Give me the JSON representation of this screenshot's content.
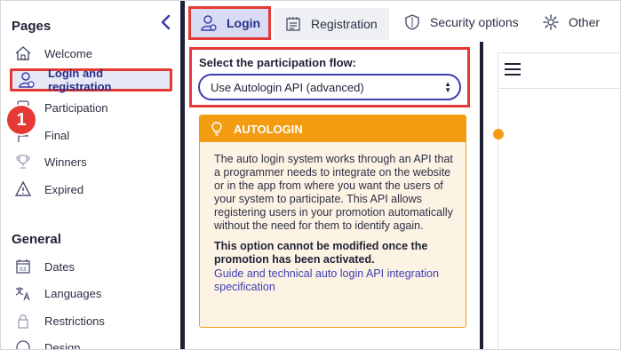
{
  "sidebar": {
    "pages_title": "Pages",
    "general_title": "General",
    "items": [
      {
        "label": "Welcome",
        "icon": "home-icon"
      },
      {
        "label": "Login and registration",
        "icon": "user-icon"
      },
      {
        "label": "Participation",
        "icon": "participation-icon"
      },
      {
        "label": "Final",
        "icon": "flag-icon"
      },
      {
        "label": "Winners",
        "icon": "trophy-icon"
      },
      {
        "label": "Expired",
        "icon": "warning-icon"
      }
    ],
    "general_items": [
      {
        "label": "Dates",
        "icon": "calendar-icon"
      },
      {
        "label": "Languages",
        "icon": "translate-icon"
      },
      {
        "label": "Restrictions",
        "icon": "lock-icon"
      },
      {
        "label": "Design",
        "icon": "palette-icon"
      }
    ],
    "step_badge": "1"
  },
  "tabs": [
    {
      "label": "Login",
      "icon": "user-icon"
    },
    {
      "label": "Registration",
      "icon": "form-icon"
    },
    {
      "label": "Security options",
      "icon": "shield-icon"
    },
    {
      "label": "Other",
      "icon": "gear-icon"
    }
  ],
  "flow": {
    "label": "Select the participation flow:",
    "selected": "Use Autologin API (advanced)"
  },
  "info": {
    "title": "AUTOLOGIN",
    "body": "The auto login system works through an API that a programmer needs to integrate on the website or in the app from where you want the users of your system to participate. This API allows registering users in your promotion automatically without the need for them to identify again.",
    "warning": "This option cannot be modified once the promotion has been activated.",
    "link": "Guide and technical auto login API integration specification"
  },
  "colors": {
    "accent": "#3b3fb0",
    "highlight": "#e53935",
    "warning": "#f39c12",
    "dark": "#1e2033"
  }
}
